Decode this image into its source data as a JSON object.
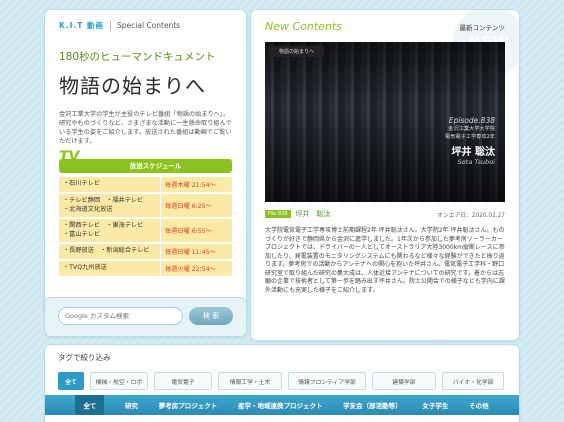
{
  "brand": {
    "logo": "K.I.T 動画",
    "section": "Special Contents"
  },
  "left": {
    "subtitle": "180秒のヒューマンドキュメント",
    "title": "物語の始まりへ",
    "description": "金沢工業大学の学生が主役のテレビ番組「物語の始まりへ」。研究やものづくりなど、さまざまな活動に一生懸命取り組んでいる学生の姿をご紹介します。放送された番組は動画でご覧いただけます。",
    "tv_badge": "TV",
    "schedule_label": "放送スケジュール",
    "schedule": [
      {
        "stations": [
          "・石川テレビ"
        ],
        "time": "毎週木曜 21:54〜"
      },
      {
        "stations": [
          "・テレビ静岡　・福井テレビ",
          "・北海道文化放送"
        ],
        "time": "毎週日曜 6:25〜"
      },
      {
        "stations": [
          "・関西テレビ　・東海テレビ",
          "・富山テレビ"
        ],
        "time": "毎週日曜 6:55〜"
      },
      {
        "stations": [
          "・長野放送　・新潟総合テレビ"
        ],
        "time": "毎週日曜 11:45〜"
      },
      {
        "stations": [
          "・TVQ九州放送"
        ],
        "time": "毎週火曜 22:54〜"
      }
    ]
  },
  "search": {
    "placeholder": "Google カスタム検索",
    "button": "検 索"
  },
  "right": {
    "watermark": "NEW",
    "new_title": "New Contents",
    "latest_link": "最新コンテンツ",
    "video": {
      "header": "物語の始まりへ",
      "episode": "Episode.838",
      "org_line1": "金沢工業大学大学院",
      "org_line2": "電気電子工学専攻2年",
      "name": "坪井 聡汰",
      "name_en": "Sota Tsuboi"
    },
    "file_badge": "File 838",
    "person": "坪井　聡汰",
    "onair": "オンエア日：2020.02.27",
    "body": "大学院電気電子工学専攻博士前期課程2年 坪井聡汰さん。大学院2年 坪井聡汰さん。ものづくりが好きで静岡県から金沢に進学しました。1年次から参加した夢考房ソーラーカープロジェクトでは、ドライバーの一人としてオーストラリア大陸3000km縦断レースに参加したり、発電装置のモニタリングシステムにも関わるなど様々な経験ができたと振り返ります。夢考房での活動からアンテナへの関心を抱いた坪井さん。電気電子工学科・野口研究室で取り組んだ研究の集大成は、人体近接アンテナについての研究です。着からは志願の企業で技術者として第一歩を踏み出す坪井さん。院士公開会での様子なども学内に課外活動にも充実した様子をご紹介します。"
  },
  "bottom": {
    "tag_title": "タグで絞り込み",
    "tags": [
      "全て",
      "機械・航空・ロボ",
      "電気電子",
      "情報工学・土木",
      "情報フロンティア学部",
      "建築学部",
      "バイオ・化学部"
    ],
    "categories": [
      "全て",
      "研究",
      "夢考房プロジェクト",
      "産学・地域連携プロジェクト",
      "学友会（部活動等）",
      "女子学生",
      "その他"
    ]
  }
}
